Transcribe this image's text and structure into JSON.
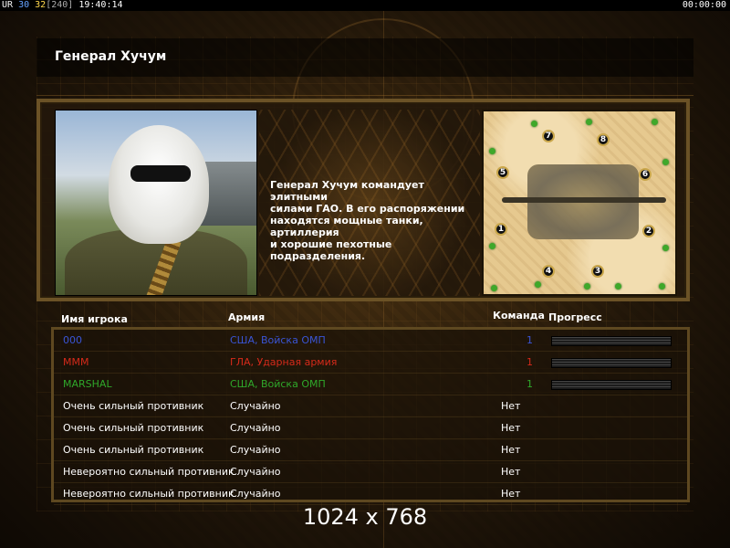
{
  "status_bar": {
    "ur": "UR",
    "val1": "30",
    "val2": "32",
    "bracket": "[240]",
    "clock": "19:40:14",
    "timer": "00:00:00"
  },
  "general": {
    "name": "Генерал Хучум",
    "description": "Генерал Хучум командует элитными\nсилами ГАО. В его распоряжении\nнаходятся мощные танки, артиллерия\nи хорошие пехотные подразделения."
  },
  "map": {
    "spots": [
      "1",
      "2",
      "3",
      "4",
      "5",
      "6",
      "7",
      "8"
    ]
  },
  "table": {
    "headers": {
      "player": "Имя игрока",
      "army": "Армия",
      "team": "Команда",
      "progress": "Прогресс"
    },
    "rows": [
      {
        "name": "000",
        "army": "США, Войска ОМП",
        "team": "1",
        "color": "#3a55d6",
        "progress": 0.0
      },
      {
        "name": "МММ",
        "army": "ГЛА, Ударная армия",
        "team": "1",
        "color": "#d62a1a",
        "progress": 0.0
      },
      {
        "name": "MARSHAL",
        "army": "США, Войска ОМП",
        "team": "1",
        "color": "#2fa82a",
        "progress": 0.0
      },
      {
        "name": "Очень сильный противник",
        "army": "Случайно",
        "team": "Нет",
        "color": "#ffffff"
      },
      {
        "name": "Очень сильный противник",
        "army": "Случайно",
        "team": "Нет",
        "color": "#ffffff"
      },
      {
        "name": "Очень сильный противник",
        "army": "Случайно",
        "team": "Нет",
        "color": "#ffffff"
      },
      {
        "name": "Невероятно сильный противник",
        "army": "Случайно",
        "team": "Нет",
        "color": "#ffffff"
      },
      {
        "name": "Невероятно сильный противник",
        "army": "Случайно",
        "team": "Нет",
        "color": "#ffffff"
      }
    ]
  },
  "resolution_text": "1024 x 768"
}
